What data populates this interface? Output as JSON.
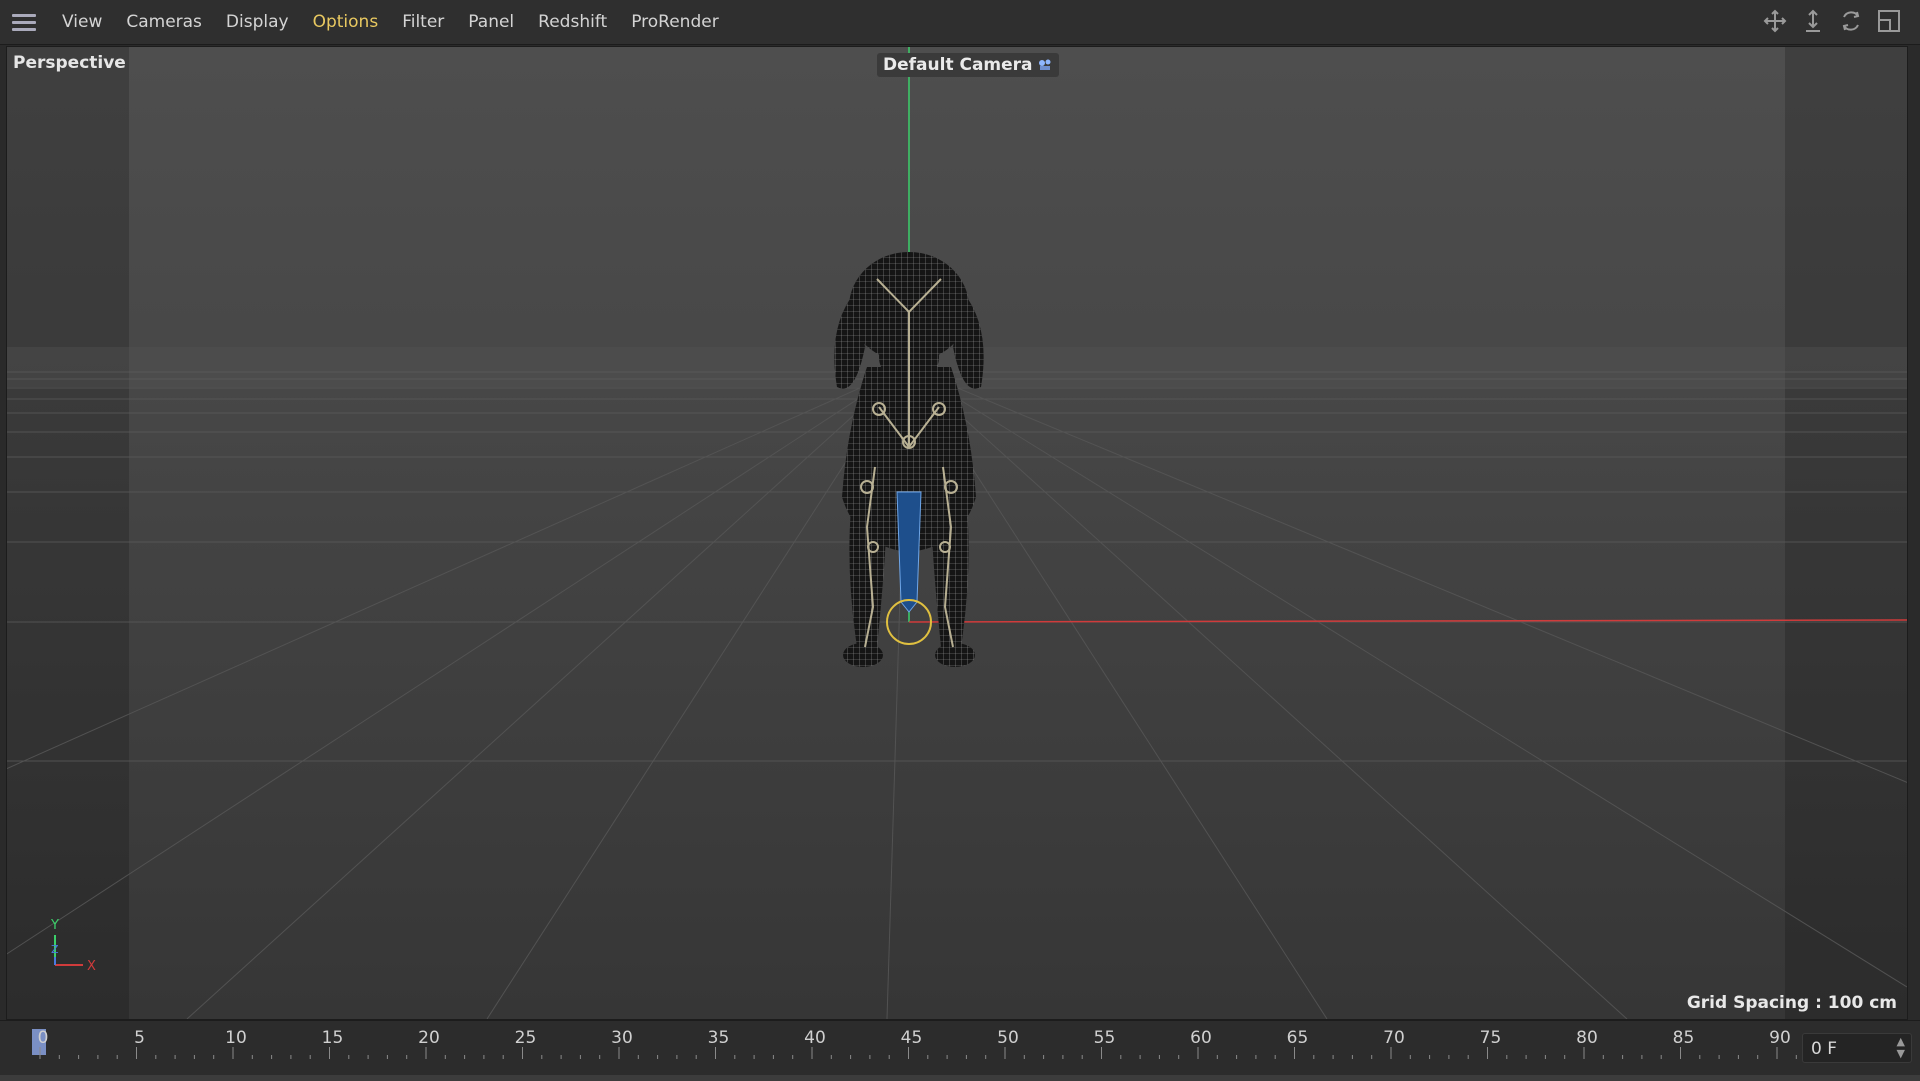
{
  "menubar": {
    "items": [
      {
        "label": "View",
        "active": false
      },
      {
        "label": "Cameras",
        "active": false
      },
      {
        "label": "Display",
        "active": false
      },
      {
        "label": "Options",
        "active": true
      },
      {
        "label": "Filter",
        "active": false
      },
      {
        "label": "Panel",
        "active": false
      },
      {
        "label": "Redshift",
        "active": false
      },
      {
        "label": "ProRender",
        "active": false
      }
    ],
    "nav_icons": [
      "move-view-icon",
      "dolly-view-icon",
      "rotate-view-icon",
      "maximize-view-icon"
    ]
  },
  "viewport": {
    "projection_label": "Perspective",
    "camera_label": "Default Camera",
    "grid_spacing": "Grid Spacing : 100 cm",
    "axis": {
      "y": "Y",
      "z": "Z",
      "x": "X"
    }
  },
  "timeline": {
    "ticks": [
      "0",
      "5",
      "10",
      "15",
      "20",
      "25",
      "30",
      "35",
      "40",
      "45",
      "50",
      "55",
      "60",
      "65",
      "70",
      "75",
      "80",
      "85",
      "90"
    ],
    "current_frame": "0 F"
  },
  "colors": {
    "accent_menu": "#e8c860",
    "y_axis": "#3bd06a",
    "x_axis": "#d03b3b",
    "bone_blue": "#1e4f8c"
  }
}
